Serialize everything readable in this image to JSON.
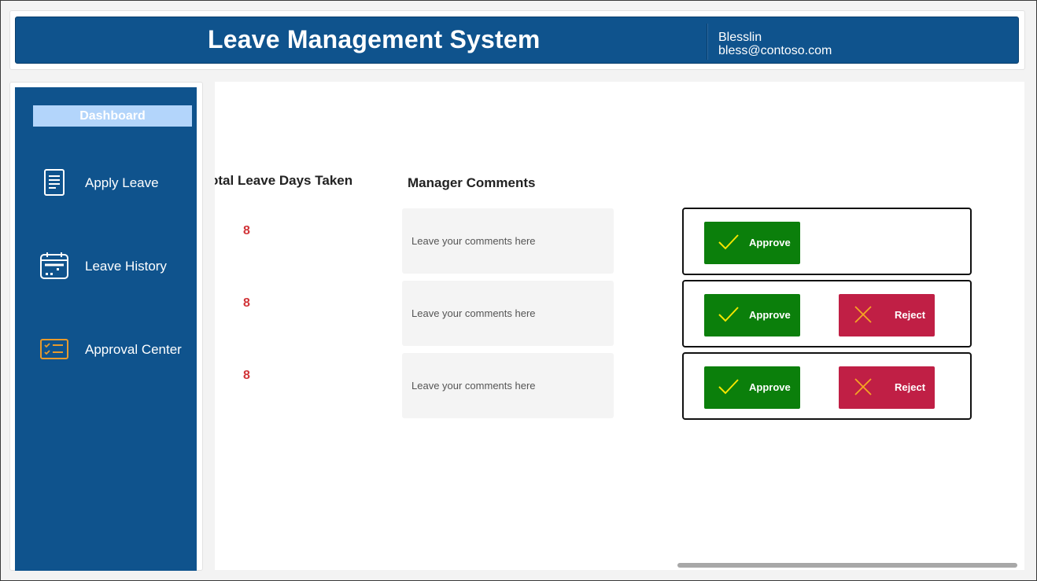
{
  "header": {
    "title": "Leave Management System",
    "user_name": "Blesslin",
    "user_email": "bless@contoso.com"
  },
  "sidebar": {
    "dashboard_label": "Dashboard",
    "items": [
      {
        "label": "Apply Leave",
        "icon": "document-icon"
      },
      {
        "label": "Leave History",
        "icon": "calendar-icon"
      },
      {
        "label": "Approval Center",
        "icon": "checklist-icon"
      }
    ]
  },
  "main": {
    "col_days_header": "otal Leave Days Taken",
    "col_comments_header": "Manager Comments",
    "rows": [
      {
        "days": "8",
        "comment_placeholder": "Leave your comments here",
        "approve_label": "Approve"
      },
      {
        "days": "8",
        "comment_placeholder": "Leave your comments here",
        "approve_label": "Approve",
        "reject_label": "Reject"
      },
      {
        "days": "8",
        "comment_placeholder": "Leave your comments here",
        "approve_label": "Approve",
        "reject_label": "Reject"
      }
    ]
  },
  "colors": {
    "brand": "#0f538d",
    "approve": "#0b7f0b",
    "reject": "#c01f45",
    "days_value": "#d13438",
    "approval_icon": "#e89a2c",
    "check_mark": "#f7e600"
  }
}
